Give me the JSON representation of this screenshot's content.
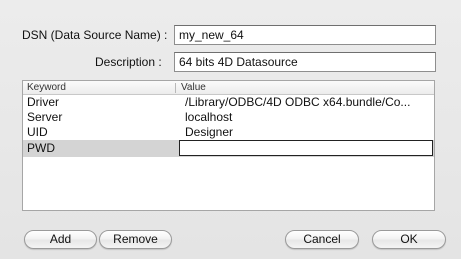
{
  "form": {
    "dsn_label": "DSN (Data Source Name) :",
    "dsn_value": "my_new_64",
    "description_label": "Description :",
    "description_value": "64 bits 4D Datasource"
  },
  "table": {
    "columns": [
      "Keyword",
      "Value"
    ],
    "rows": [
      {
        "keyword": "Driver",
        "value": "/Library/ODBC/4D ODBC x64.bundle/Co..."
      },
      {
        "keyword": "Server",
        "value": "localhost"
      },
      {
        "keyword": "UID",
        "value": "Designer"
      },
      {
        "keyword": "PWD",
        "value": ""
      }
    ],
    "selected_row": "PWD"
  },
  "buttons": {
    "add": "Add",
    "remove": "Remove",
    "cancel": "Cancel",
    "ok": "OK"
  }
}
